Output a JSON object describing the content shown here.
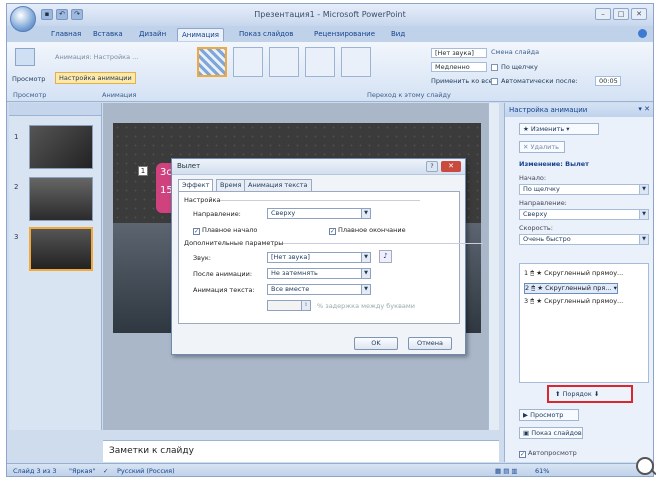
{
  "window": {
    "title": "Презентация1 - Microsoft PowerPoint"
  },
  "tabs": [
    "Главная",
    "Вставка",
    "Дизайн",
    "Анимация",
    "Показ слайдов",
    "Рецензирование",
    "Вид"
  ],
  "active_tab": "Анимация",
  "ribbon": {
    "preview_label": "Просмотр",
    "animation_combo": "Анимация: Настройка ...",
    "custom_anim_btn": "Настройка анимации",
    "group_preview": "Просмотр",
    "group_anim": "Анимация",
    "group_transition": "Переход к этому слайду",
    "sound_value": "[Нет звука]",
    "speed_value": "Медленно",
    "apply_all": "Применить ко всем",
    "advance_title": "Смена слайда",
    "on_click": "По щелчку",
    "auto_after": "Автоматически после:",
    "auto_time": "00:05"
  },
  "thumbnails": [
    {
      "num": "1"
    },
    {
      "num": "2"
    },
    {
      "num": "3"
    }
  ],
  "slide": {
    "tag": "1",
    "text1": "3с",
    "text2": "15"
  },
  "notes_placeholder": "Заметки к слайду",
  "taskpane": {
    "title": "Настройка анимации",
    "change_btn": "Изменить",
    "delete_btn": "Удалить",
    "change_label": "Изменение: Вылет",
    "start_label": "Начало:",
    "start_value": "По щелчку",
    "direction_label": "Направление:",
    "direction_value": "Сверху",
    "speed_label": "Скорость:",
    "speed_value": "Очень быстро",
    "items": [
      {
        "num": "1",
        "text": "Скругленный прямоу..."
      },
      {
        "num": "2",
        "text": "Скругленный пря..."
      },
      {
        "num": "3",
        "text": "Скругленный прямоу..."
      }
    ],
    "order_label": "Порядок",
    "play_btn": "Просмотр",
    "slideshow_btn": "Показ слайдов",
    "autopreview": "Автопросмотр"
  },
  "status": {
    "slide": "Слайд 3 из 3",
    "theme": "\"Яркая\"",
    "lang": "Русский (Россия)",
    "zoom": "61%"
  },
  "dialog": {
    "title": "Вылет",
    "tabs": [
      "Эффект",
      "Время",
      "Анимация текста"
    ],
    "section_settings": "Настройка",
    "direction_label": "Направление:",
    "direction_value": "Сверху",
    "smooth_start": "Плавное начало",
    "smooth_end": "Плавное окончание",
    "section_extra": "Дополнительные параметры",
    "sound_label": "Звук:",
    "sound_value": "[Нет звука]",
    "after_label": "После анимации:",
    "after_value": "Не затемнять",
    "text_anim_label": "Анимация текста:",
    "text_anim_value": "Все вместе",
    "delay_label": "% задержка между буквами",
    "ok": "OK",
    "cancel": "Отмена"
  }
}
